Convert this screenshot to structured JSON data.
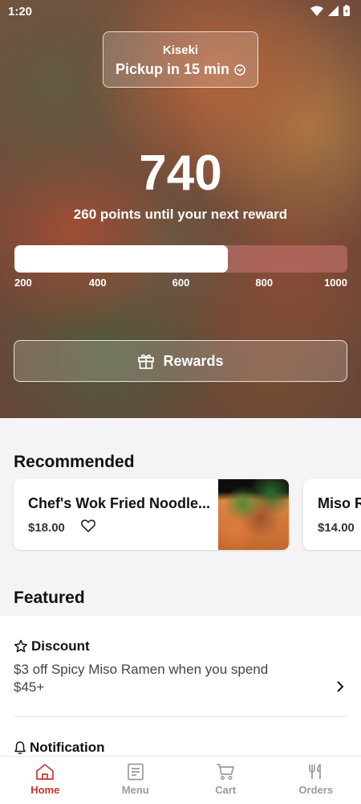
{
  "status_bar": {
    "time": "1:20"
  },
  "pickup": {
    "store": "Kiseki",
    "eta": "Pickup in 15 min"
  },
  "rewards": {
    "points": "740",
    "subtitle": "260 points until your next reward",
    "progress_fraction": 0.64,
    "ticks": [
      "200",
      "400",
      "600",
      "800",
      "1000"
    ],
    "button_label": "Rewards"
  },
  "recommended": {
    "title": "Recommended",
    "items": [
      {
        "name": "Chef's Wok Fried Noodle...",
        "price": "$18.00"
      },
      {
        "name": "Miso R",
        "price": "$14.00"
      }
    ]
  },
  "featured": {
    "title": "Featured",
    "items": [
      {
        "heading": "Discount",
        "body": "$3 off Spicy Miso Ramen when you spend $45+"
      },
      {
        "heading": "Notification",
        "body": ""
      }
    ]
  },
  "tabs": [
    {
      "label": "Home",
      "icon": "home-icon",
      "active": true
    },
    {
      "label": "Menu",
      "icon": "menu-icon",
      "active": false
    },
    {
      "label": "Cart",
      "icon": "cart-icon",
      "active": false
    },
    {
      "label": "Orders",
      "icon": "orders-icon",
      "active": false
    }
  ],
  "colors": {
    "accent": "#c8372d",
    "inactive_tab": "#9a9a9a"
  }
}
